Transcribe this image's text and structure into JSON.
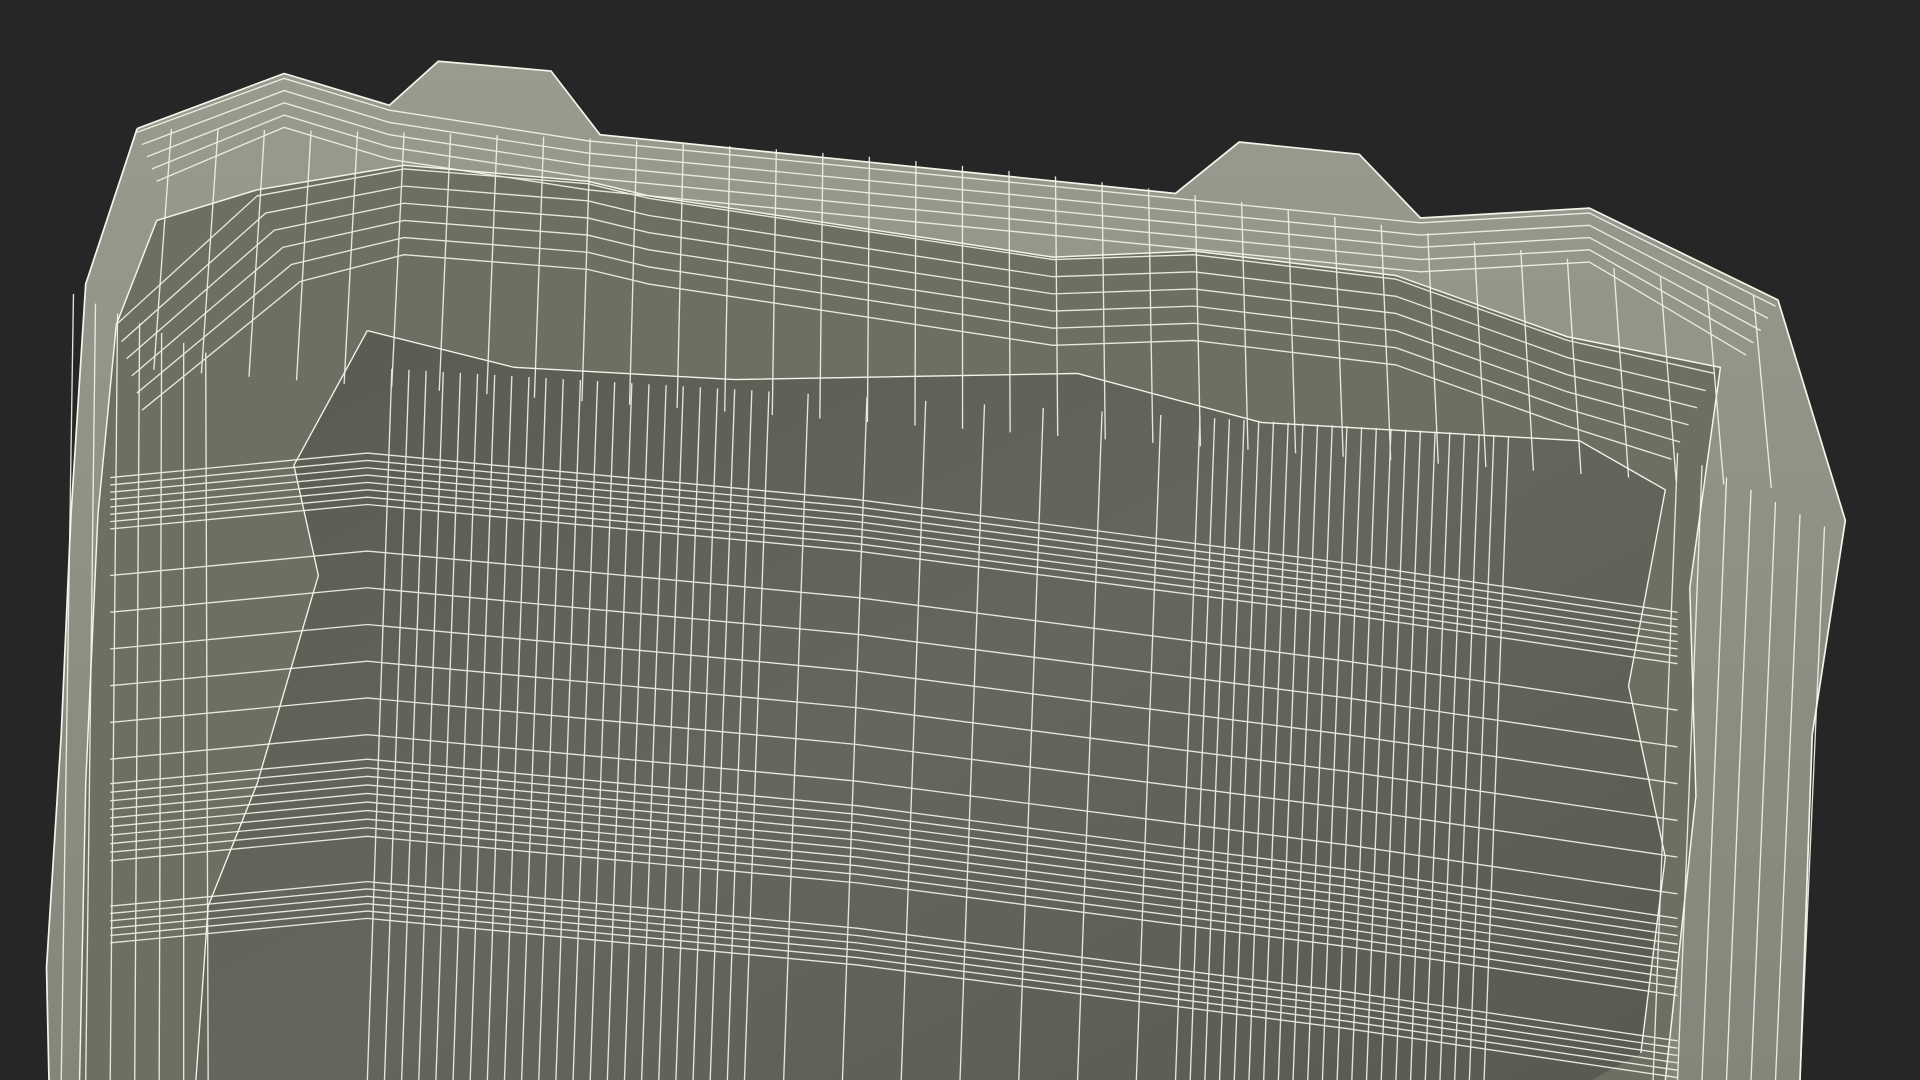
{
  "scene": {
    "subject": "wireframe-tray-model",
    "colors": {
      "background": "#262626",
      "rim_surface": "#8c8c80",
      "rim_surface_light": "#9a9a8e",
      "wall_surface": "#6e6e63",
      "floor_surface": "#5f5f56",
      "floor_surface_dark": "#4f4f48",
      "wire": "#f2f2e8"
    }
  }
}
